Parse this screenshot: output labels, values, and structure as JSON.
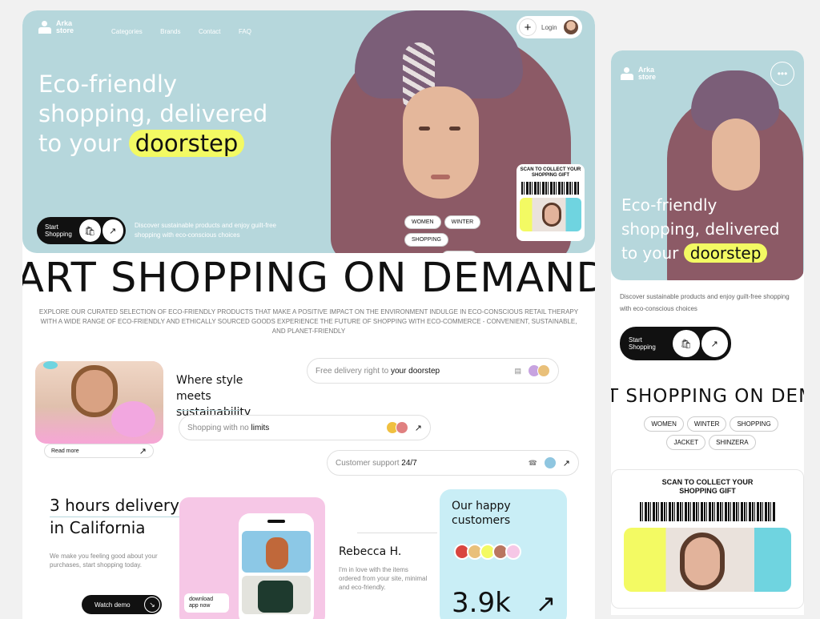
{
  "brand": {
    "line1": "Arka",
    "line2": "store"
  },
  "nav": [
    "Categories",
    "Brands",
    "Contact",
    "FAQ"
  ],
  "login_label": "Login",
  "hero": {
    "title_line1": "Eco-friendly",
    "title_line2": "shopping, delivered",
    "title_line3_prefix": "to your",
    "title_highlight": "doorstep",
    "start_label_1": "Start",
    "start_label_2": "Shopping",
    "description": "Discover sustainable products and enjoy guilt-free shopping with eco-conscious choices",
    "tags": [
      "WOMEN",
      "WINTER",
      "SHOPPING",
      "JACKET",
      "SHINZERA"
    ],
    "scan_label": "SCAN TO COLLECT YOUR SHOPPING GIFT"
  },
  "marquee": "ART SHOPPING ON DEMAND",
  "intro": "EXPLORE OUR CURATED SELECTION OF ECO-FRIENDLY PRODUCTS THAT MAKE A POSITIVE IMPACT ON THE ENVIRONMENT INDULGE IN ECO-CONSCIOUS RETAIL THERAPY WITH A WIDE RANGE OF ECO-FRIENDLY AND ETHICALLY SOURCED GOODS EXPERIENCE THE FUTURE OF SHOPPING WITH ECO-COMMERCE - CONVENIENT, SUSTAINABLE, AND PLANET-FRIENDLY",
  "features": {
    "style_title": "Where style meets sustainability",
    "read_more": "Read more",
    "delivery_prefix": "Free delivery right to",
    "delivery_bold": "your doorstep",
    "limits_prefix": "Shopping with no",
    "limits_bold": "limits",
    "support_prefix": "Customer support",
    "support_bold": "24/7"
  },
  "delivery": {
    "title_line1": "3 hours delivery",
    "title_line2": "in California",
    "text": "We make you feeling good about your purchases, start shopping today.",
    "watch_demo": "Watch demo",
    "download_1": "download",
    "download_2": "app now"
  },
  "review": {
    "name": "Rebecca H.",
    "text": "I'm in love with the items ordered from your site, minimal and eco-friendly."
  },
  "customers": {
    "title_line1": "Our happy",
    "title_line2": "customers",
    "count": "3.9k"
  },
  "mobile": {
    "marquee": "T SHOPPING ON DEM",
    "scan_line1": "SCAN TO COLLECT YOUR",
    "scan_line2": "SHOPPING GIFT"
  },
  "colors": {
    "hero_bg": "#b6d7dc",
    "highlight": "#f3fa63",
    "pink": "#f6c7e6",
    "light_blue": "#c9eef6"
  }
}
